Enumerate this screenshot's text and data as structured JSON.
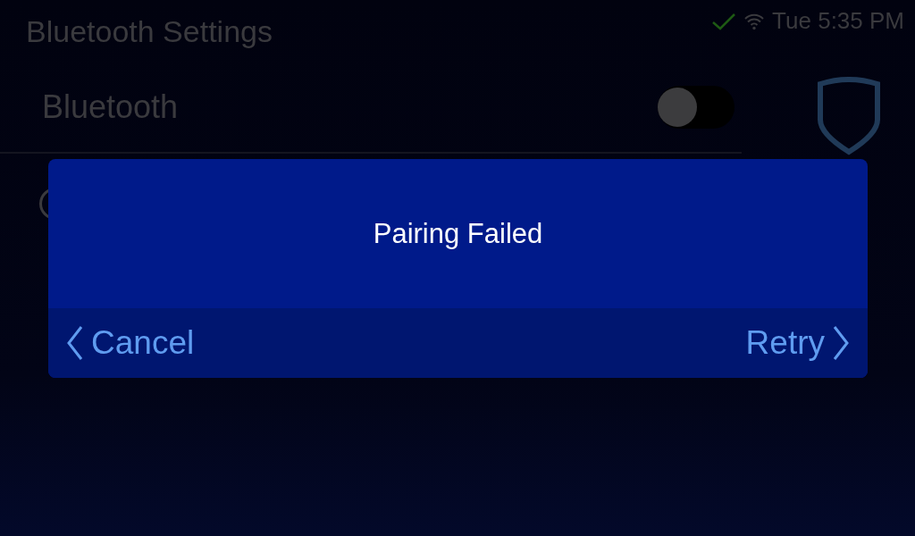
{
  "header": {
    "title": "Bluetooth Settings",
    "status": {
      "connected": true,
      "time": "Tue 5:35 PM"
    }
  },
  "settings": [
    {
      "kind": "toggle",
      "label": "Bluetooth",
      "on": false
    }
  ],
  "dialog": {
    "message": "Pairing Failed",
    "buttons": [
      {
        "kind": "back",
        "label": "Cancel"
      },
      {
        "kind": "forward",
        "label": "Retry"
      }
    ]
  }
}
